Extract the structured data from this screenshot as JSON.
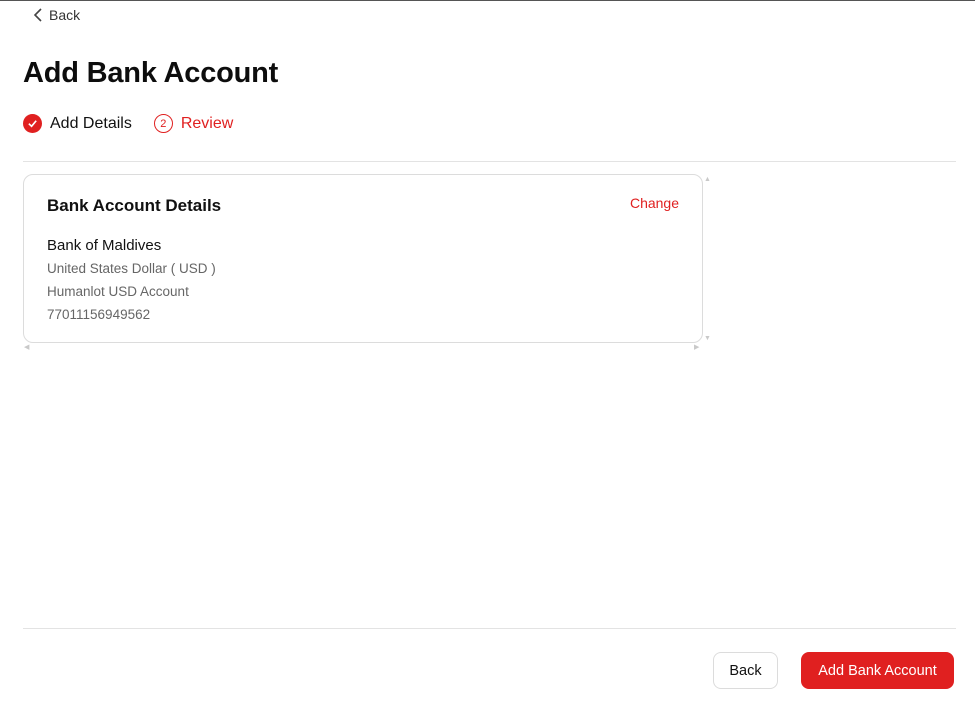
{
  "nav": {
    "back_label": "Back"
  },
  "page": {
    "title": "Add Bank Account"
  },
  "stepper": {
    "steps": [
      {
        "label": "Add Details",
        "status": "completed"
      },
      {
        "number": "2",
        "label": "Review",
        "status": "active"
      }
    ]
  },
  "card": {
    "title": "Bank Account Details",
    "change_label": "Change",
    "bank_name": "Bank of Maldives",
    "currency": "United States Dollar  ( USD )",
    "account_name": "Humanlot USD Account",
    "account_number": "77011156949562"
  },
  "footer": {
    "back_label": "Back",
    "submit_label": "Add Bank Account"
  },
  "colors": {
    "accent": "#e02020",
    "border": "#dcdcdc",
    "muted_text": "#666666"
  },
  "icons": {
    "back": "chevron-left-icon",
    "step_done": "check-circle-icon"
  }
}
